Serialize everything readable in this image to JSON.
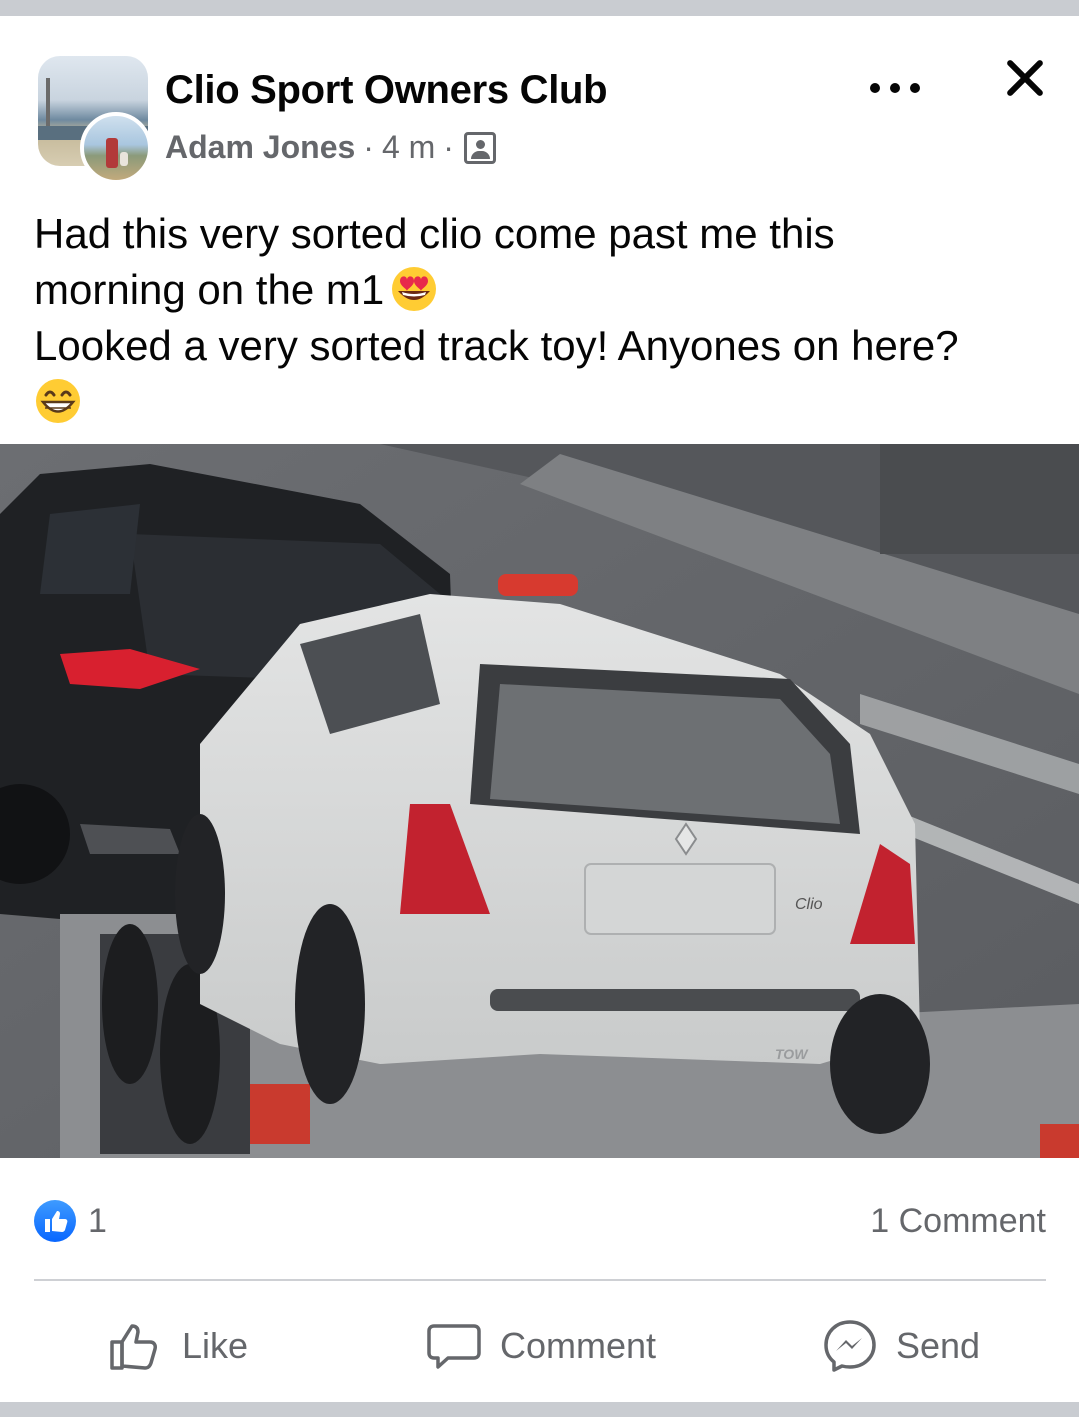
{
  "post": {
    "group_name": "Clio Sport Owners Club",
    "author": "Adam Jones",
    "separator": "·",
    "time": "4 m",
    "privacy_icon": "group-members-icon",
    "text_lines": [
      "Had this very sorted clio come past me this",
      "morning on the m1",
      "Looked a very sorted track toy! Anyones on here?"
    ],
    "emojis": [
      "heart-eyes-emoji",
      "grinning-emoji"
    ]
  },
  "photo": {
    "car_badge_text": "Clio",
    "trailer_text": "TOW"
  },
  "stats": {
    "like_count": "1",
    "comment_count": "1 Comment"
  },
  "actions": {
    "like_label": "Like",
    "comment_label": "Comment",
    "send_label": "Send"
  },
  "colors": {
    "accent": "#0866ff",
    "secondary_text": "#65676b",
    "divider": "#ced0d4"
  }
}
